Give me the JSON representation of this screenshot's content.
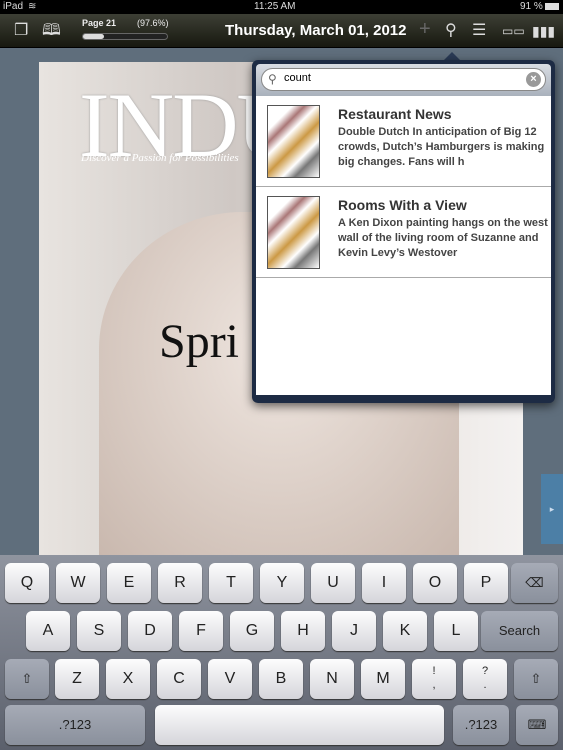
{
  "status": {
    "device": "iPad",
    "time": "11:25 AM",
    "battery": "91 %"
  },
  "toolbar": {
    "page": "Page 21",
    "percent": "(97.6%)",
    "progress": 0.25,
    "date": "Thursday, March 01, 2012"
  },
  "cover": {
    "logo": "INDU",
    "tagline": "Discover a Passion for Possibilities",
    "headline": "Spri"
  },
  "search": {
    "query": "count",
    "results": [
      {
        "title": "Restaurant News",
        "desc": "Double Dutch In anticipation of Big 12 crowds, Dutch’s Hamburgers is making big changes. Fans will h"
      },
      {
        "title": "Rooms With a View",
        "desc": "A Ken Dixon painting hangs on the west wall of the living room of Suzanne and Kevin Levy’s Westover"
      }
    ]
  },
  "keyboard": {
    "row1": [
      "Q",
      "W",
      "E",
      "R",
      "T",
      "Y",
      "U",
      "I",
      "O",
      "P"
    ],
    "row2": [
      "A",
      "S",
      "D",
      "F",
      "G",
      "H",
      "J",
      "K",
      "L"
    ],
    "row3": [
      "Z",
      "X",
      "C",
      "V",
      "B",
      "N",
      "M"
    ],
    "punct1": "!\n,",
    "punct2": "?\n.",
    "search": "Search",
    "numbers": ".?123",
    "shift": "⇧",
    "backspace": "⌫",
    "hide": "⌨"
  }
}
